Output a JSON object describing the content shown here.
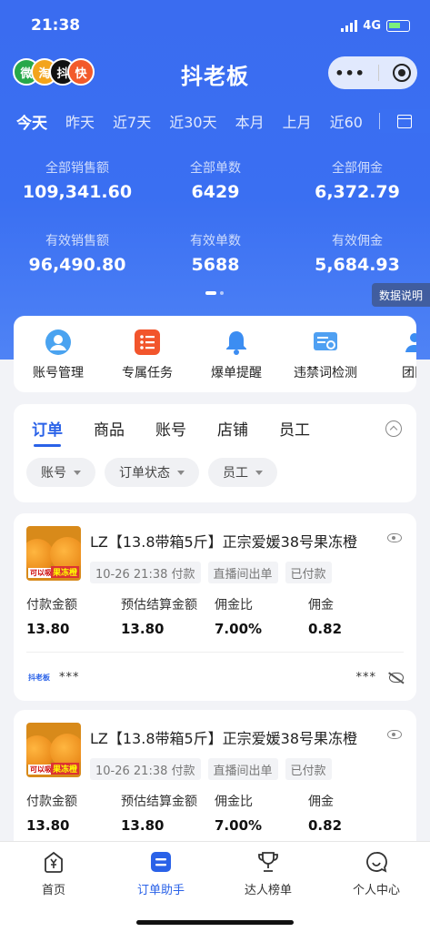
{
  "status": {
    "time": "21:38",
    "network": "4G"
  },
  "header": {
    "app_title": "抖老板",
    "avatars": [
      {
        "label": "微",
        "color": "#27a84a"
      },
      {
        "label": "淘",
        "color": "#f3a41c"
      },
      {
        "label": "抖",
        "color": "#111111"
      },
      {
        "label": "快",
        "color": "#f25a2b"
      }
    ],
    "capsule_more": "•••"
  },
  "date_tabs": [
    "今天",
    "昨天",
    "近7天",
    "近30天",
    "本月",
    "上月",
    "近60"
  ],
  "stats": {
    "row1": [
      {
        "label": "全部销售额",
        "value": "109,341.60"
      },
      {
        "label": "全部单数",
        "value": "6429"
      },
      {
        "label": "全部佣金",
        "value": "6,372.79"
      }
    ],
    "row2": [
      {
        "label": "有效销售额",
        "value": "96,490.80"
      },
      {
        "label": "有效单数",
        "value": "5688"
      },
      {
        "label": "有效佣金",
        "value": "5,684.93"
      }
    ],
    "explain_label": "数据说明"
  },
  "shortcuts": [
    {
      "label": "账号管理",
      "icon": "user-icon"
    },
    {
      "label": "专属任务",
      "icon": "task-list-icon"
    },
    {
      "label": "爆单提醒",
      "icon": "bell-icon"
    },
    {
      "label": "违禁词检测",
      "icon": "word-check-icon"
    },
    {
      "label": "团队",
      "icon": "team-icon"
    }
  ],
  "tabs": {
    "items": [
      "订单",
      "商品",
      "账号",
      "店铺",
      "员工"
    ],
    "active": 0,
    "filters": [
      "账号",
      "订单状态",
      "员工"
    ]
  },
  "orders": [
    {
      "title": "LZ【13.8带箱5斤】正宗爱媛38号果冻橙",
      "tags": [
        "10-26 21:38 付款",
        "直播间出单",
        "已付款"
      ],
      "metrics": [
        {
          "label": "付款金额",
          "value": "13.80"
        },
        {
          "label": "预估结算金额",
          "value": "13.80"
        },
        {
          "label": "佣金比",
          "value": "7.00%"
        },
        {
          "label": "佣金",
          "value": "0.82"
        }
      ],
      "shop_logo": "抖老板",
      "masked_left": "***",
      "masked_right": "***",
      "thumb_tag": "可以吸的",
      "thumb_tag2": "果冻橙"
    },
    {
      "title": "LZ【13.8带箱5斤】正宗爱媛38号果冻橙",
      "tags": [
        "10-26 21:38 付款",
        "直播间出单",
        "已付款"
      ],
      "metrics": [
        {
          "label": "付款金额",
          "value": "13.80"
        },
        {
          "label": "预估结算金额",
          "value": "13.80"
        },
        {
          "label": "佣金比",
          "value": "7.00%"
        },
        {
          "label": "佣金",
          "value": "0.82"
        }
      ],
      "thumb_tag": "可以吸的",
      "thumb_tag2": "果冻橙"
    }
  ],
  "bottom_nav": [
    {
      "label": "首页",
      "icon": "home-yuan-icon"
    },
    {
      "label": "订单助手",
      "icon": "order-assistant-icon"
    },
    {
      "label": "达人榜单",
      "icon": "trophy-icon"
    },
    {
      "label": "个人中心",
      "icon": "chat-smile-icon"
    }
  ],
  "colors": {
    "primary": "#2a62e8",
    "hero": "#3a6ff2"
  }
}
